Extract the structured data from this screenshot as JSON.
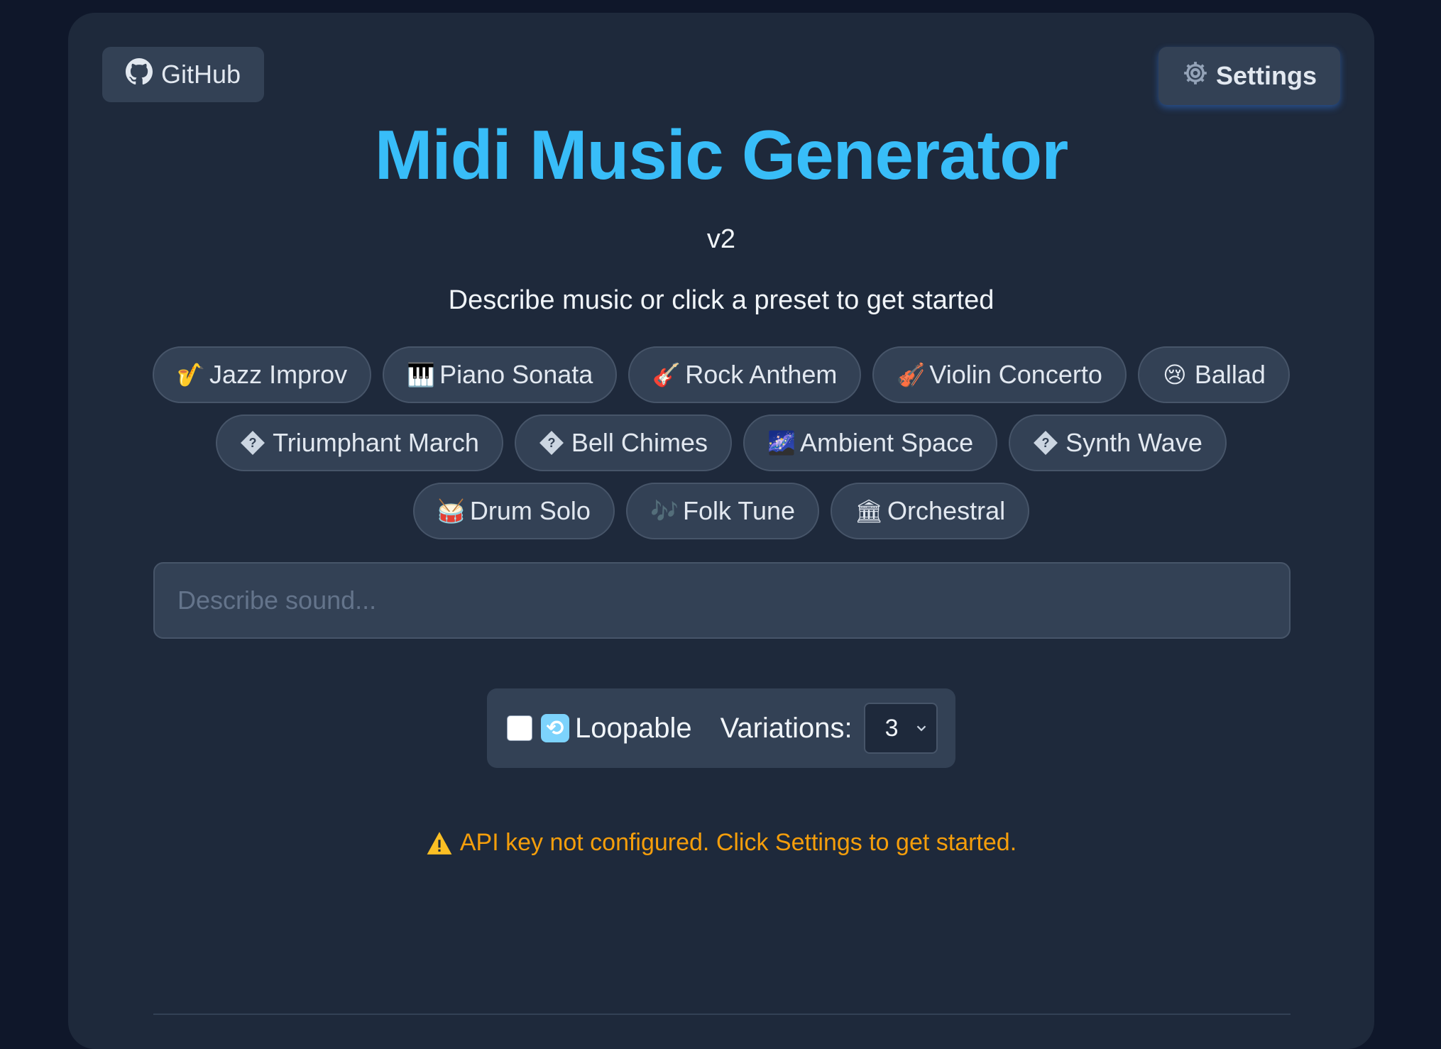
{
  "header": {
    "github_label": "GitHub",
    "settings_label": "Settings",
    "title": "Midi Music Generator",
    "version": "v2",
    "subtitle": "Describe music or click a preset to get started"
  },
  "presets": [
    [
      {
        "icon": "🎷",
        "label": "Jazz Improv"
      },
      {
        "icon": "🎹",
        "label": "Piano Sonata"
      },
      {
        "icon": "🎸",
        "label": "Rock Anthem"
      },
      {
        "icon": "🎻",
        "label": "Violin Concerto"
      },
      {
        "icon": "😢",
        "label": "Ballad"
      }
    ],
    [
      {
        "icon": "?",
        "label": "Triumphant March"
      },
      {
        "icon": "?",
        "label": "Bell Chimes"
      },
      {
        "icon": "🌌",
        "label": "Ambient Space"
      },
      {
        "icon": "?",
        "label": "Synth Wave"
      }
    ],
    [
      {
        "icon": "🥁",
        "label": "Drum Solo"
      },
      {
        "icon": "🎶",
        "label": "Folk Tune"
      },
      {
        "icon": "🏛",
        "label": "Orchestral"
      }
    ]
  ],
  "search": {
    "placeholder": "Describe sound...",
    "value": ""
  },
  "options": {
    "loopable_label": "Loopable",
    "loopable_checked": false,
    "variations_label": "Variations:",
    "variations_value": "3"
  },
  "warning": {
    "text": "API key not configured. Click Settings to get started."
  },
  "colors": {
    "background": "#0f172a",
    "card": "#1e293b",
    "accent": "#38bdf8",
    "warning": "#f59e0b"
  }
}
